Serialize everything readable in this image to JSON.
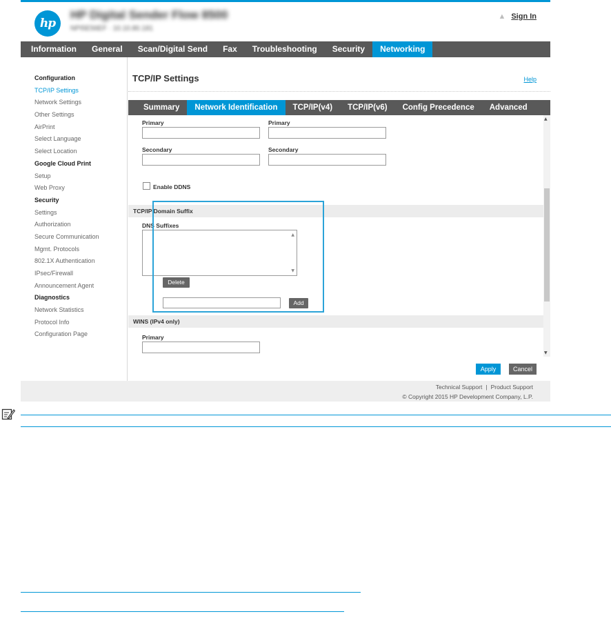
{
  "header": {
    "logo_text": "hp",
    "device_name": "HP Digital Sender Flow 8500",
    "device_subtitle": "NPI5E56EF · 10.10.80.181",
    "sign_in": "Sign In"
  },
  "main_tabs": [
    {
      "label": "Information",
      "active": false
    },
    {
      "label": "General",
      "active": false
    },
    {
      "label": "Scan/Digital Send",
      "active": false
    },
    {
      "label": "Fax",
      "active": false
    },
    {
      "label": "Troubleshooting",
      "active": false
    },
    {
      "label": "Security",
      "active": false
    },
    {
      "label": "Networking",
      "active": true
    }
  ],
  "sidebar": [
    {
      "label": "Configuration",
      "type": "head"
    },
    {
      "label": "TCP/IP Settings",
      "type": "active"
    },
    {
      "label": "Network Settings",
      "type": "link"
    },
    {
      "label": "Other Settings",
      "type": "link"
    },
    {
      "label": "AirPrint",
      "type": "link"
    },
    {
      "label": "Select Language",
      "type": "link"
    },
    {
      "label": "Select Location",
      "type": "link"
    },
    {
      "label": "Google Cloud Print",
      "type": "head"
    },
    {
      "label": "Setup",
      "type": "link"
    },
    {
      "label": "Web Proxy",
      "type": "link"
    },
    {
      "label": "Security",
      "type": "head"
    },
    {
      "label": "Settings",
      "type": "link"
    },
    {
      "label": "Authorization",
      "type": "link"
    },
    {
      "label": "Secure Communication",
      "type": "link"
    },
    {
      "label": "Mgmt. Protocols",
      "type": "link"
    },
    {
      "label": "802.1X Authentication",
      "type": "link"
    },
    {
      "label": "IPsec/Firewall",
      "type": "link"
    },
    {
      "label": "Announcement Agent",
      "type": "link"
    },
    {
      "label": "Diagnostics",
      "type": "head"
    },
    {
      "label": "Network Statistics",
      "type": "link"
    },
    {
      "label": "Protocol Info",
      "type": "link"
    },
    {
      "label": "Configuration Page",
      "type": "link"
    }
  ],
  "content": {
    "title": "TCP/IP Settings",
    "help": "Help"
  },
  "sub_tabs": [
    {
      "label": "Summary",
      "active": false
    },
    {
      "label": "Network Identification",
      "active": true
    },
    {
      "label": "TCP/IP(v4)",
      "active": false
    },
    {
      "label": "TCP/IP(v6)",
      "active": false
    },
    {
      "label": "Config Precedence",
      "active": false
    },
    {
      "label": "Advanced",
      "active": false
    }
  ],
  "form": {
    "primary_label": "Primary",
    "secondary_label": "Secondary",
    "primary_value_a": "",
    "primary_value_b": "",
    "secondary_value_a": "",
    "secondary_value_b": "",
    "enable_ddns_label": "Enable DDNS",
    "enable_ddns_checked": false,
    "domain_suffix_section": "TCP/IP Domain Suffix",
    "dns_suffixes_label": "DNS Suffixes",
    "dns_suffixes": [],
    "delete_button": "Delete",
    "suffix_input_value": "",
    "add_button": "Add",
    "wins_section": "WINS (IPv4 only)",
    "wins_primary_label": "Primary",
    "wins_primary_value": ""
  },
  "actions": {
    "apply": "Apply",
    "cancel": "Cancel"
  },
  "footer": {
    "technical_support": "Technical Support",
    "separator": "|",
    "product_support": "Product Support",
    "copyright": "© Copyright 2015 HP Development Company, L.P."
  },
  "colors": {
    "accent": "#0096d6",
    "nav_background": "#595959",
    "highlight_box": "#2aa3d8"
  },
  "icons": {
    "note": "note-pencil-icon",
    "home": "home-icon"
  }
}
